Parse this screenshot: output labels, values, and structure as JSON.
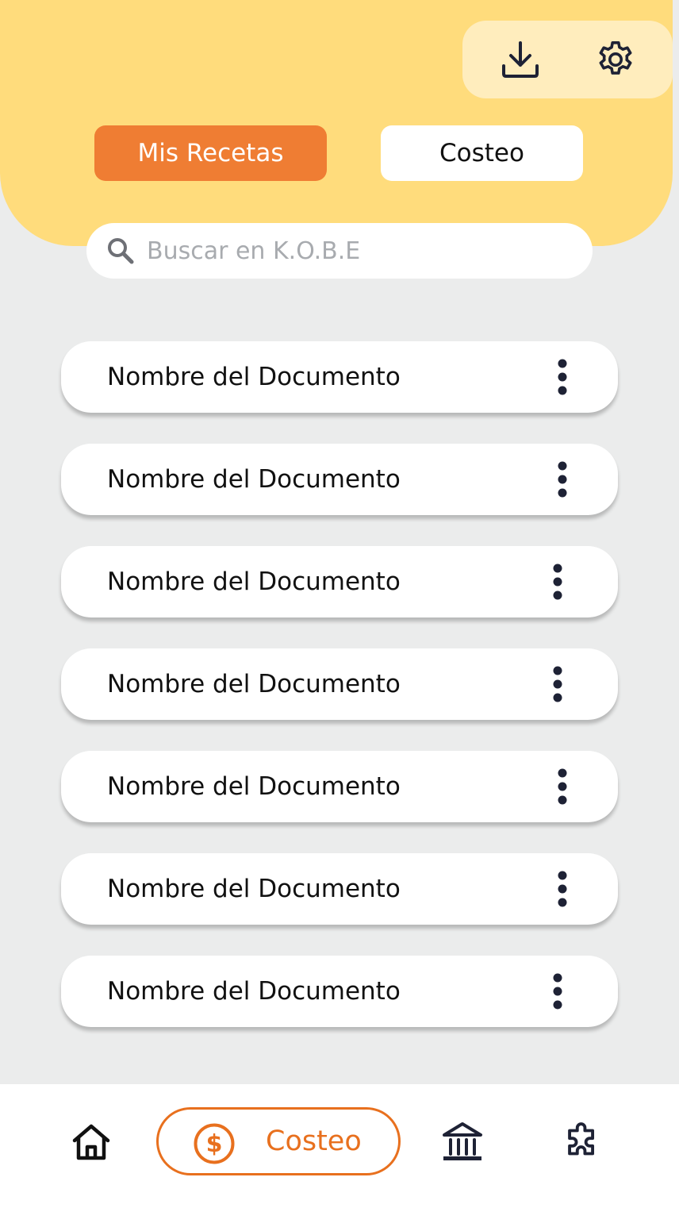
{
  "header": {
    "tabs": [
      {
        "label": "Mis Recetas",
        "active": true
      },
      {
        "label": "Costeo",
        "active": false
      }
    ]
  },
  "search": {
    "placeholder": "Buscar en K.O.B.E",
    "value": ""
  },
  "documents": [
    {
      "name": "Nombre del Documento"
    },
    {
      "name": "Nombre del Documento"
    },
    {
      "name": "Nombre del Documento"
    },
    {
      "name": "Nombre del Documento"
    },
    {
      "name": "Nombre del Documento"
    },
    {
      "name": "Nombre del Documento"
    },
    {
      "name": "Nombre del Documento"
    }
  ],
  "bottom_nav": {
    "items": [
      {
        "icon": "home-icon"
      },
      {
        "icon": "dollar-icon",
        "label": "Costeo",
        "active": true
      },
      {
        "icon": "bank-icon"
      },
      {
        "icon": "puzzle-icon"
      }
    ]
  },
  "colors": {
    "header_bg": "#FFDC7C",
    "header_actions_bg": "#FFEDBD",
    "accent_orange": "#EF7D33",
    "active_nav": "#E8701E",
    "page_bg": "#EBECEC",
    "icon_dark": "#1E2235"
  }
}
